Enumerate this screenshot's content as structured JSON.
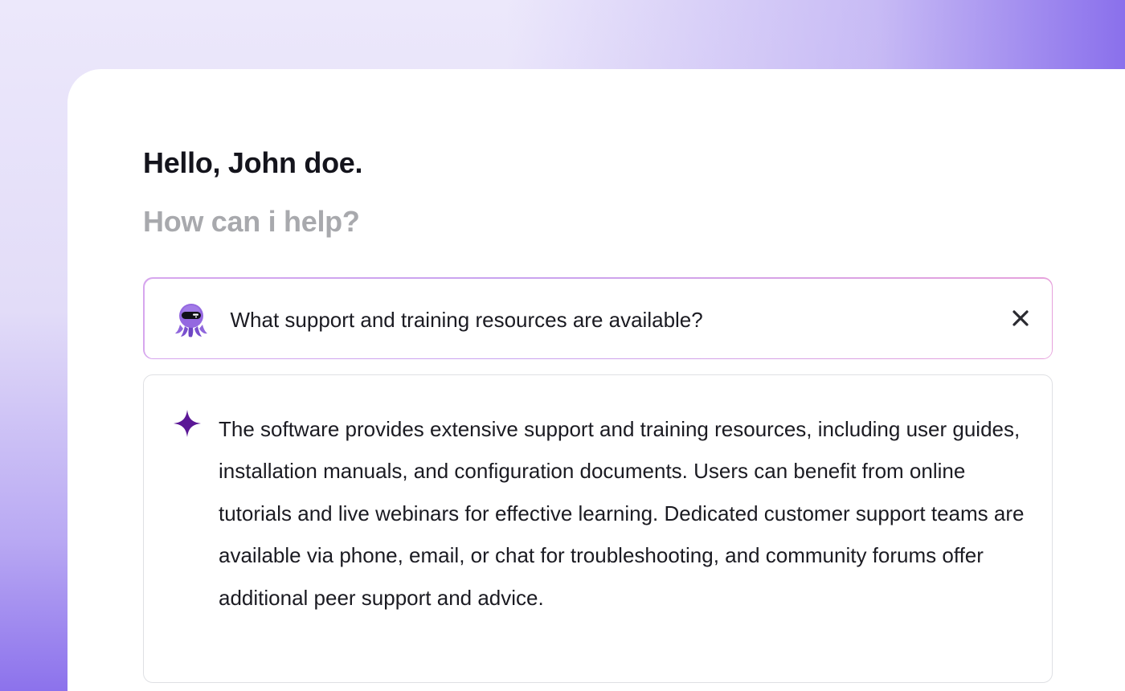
{
  "greeting": "Hello, John doe.",
  "subgreeting": "How can i help?",
  "question": {
    "text": "What support and training resources are available?",
    "avatar_icon": "octopus-mascot-icon",
    "close_icon": "close-icon"
  },
  "answer": {
    "icon": "sparkle-icon",
    "text": "The software provides extensive support and training resources, including user guides, installation manuals, and configuration documents. Users can benefit from online tutorials and live webinars for effective learning. Dedicated customer support teams are available via phone, email, or chat for troubleshooting, and community forums offer additional peer support and advice."
  },
  "colors": {
    "accent": "#8a70ec",
    "sparkle": "#5b1796",
    "mascot": "#8a5fd6",
    "question_border": "#d7a7ee",
    "answer_border": "#dfe0e4",
    "muted_text": "#a8a9ad"
  }
}
